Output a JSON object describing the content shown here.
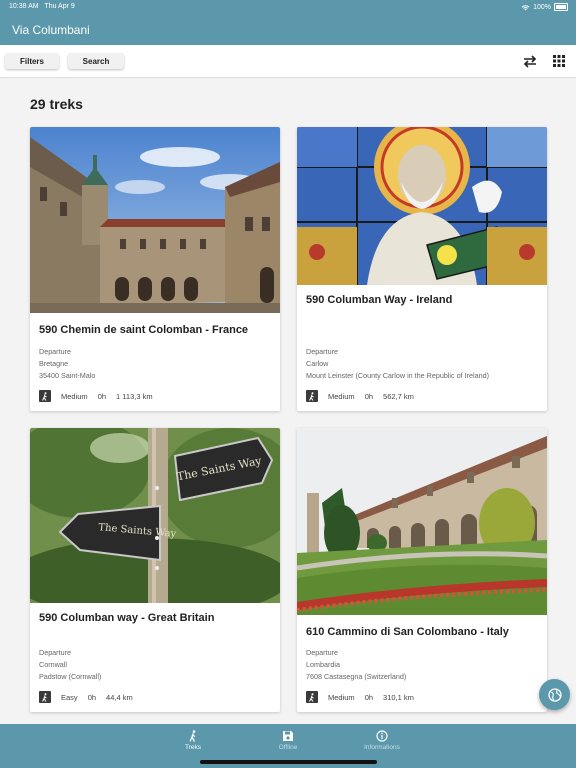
{
  "status": {
    "time": "10:38 AM",
    "date": "Thu Apr 9",
    "battery": "100%"
  },
  "app": {
    "title": "Via Columbani",
    "accent": "#5b98ac"
  },
  "toolbar": {
    "filters_label": "Filters",
    "search_label": "Search",
    "swap_icon": "swap-icon",
    "grid_icon": "grid-icon"
  },
  "list": {
    "count_label": "29 treks"
  },
  "cards": [
    {
      "title": "590 Chemin de saint Colomban - France",
      "departure_label": "Departure",
      "region": "Bretagne",
      "place": "35400 Saint-Malo",
      "difficulty": "Medium",
      "duration": "0h",
      "distance": "1 113,3 km",
      "image": "abbey-courtyard-photo"
    },
    {
      "title": "590 Columban Way - Ireland",
      "departure_label": "Departure",
      "region": "Carlow",
      "place": "Mount Leinster (County Carlow in the Republic of Ireland)",
      "difficulty": "Medium",
      "duration": "0h",
      "distance": "562,7 km",
      "image": "stained-glass-saint-photo"
    },
    {
      "title": "590 Columban way - Great Britain",
      "departure_label": "Departure",
      "region": "Cornwall",
      "place": "Padstow (Cornwall)",
      "difficulty": "Easy",
      "duration": "0h",
      "distance": "44,4 km",
      "image": "saints-way-signpost-photo",
      "sign_text_1": "The Saints Way",
      "sign_text_2": "The Saints Way"
    },
    {
      "title": "610 Cammino di San Colombano - Italy",
      "departure_label": "Departure",
      "region": "Lombardia",
      "place": "7608 Castasegna (Switzerland)",
      "difficulty": "Medium",
      "duration": "0h",
      "distance": "310,1 km",
      "image": "italian-cloister-garden-photo"
    }
  ],
  "tabs": [
    {
      "label": "Treks",
      "icon": "hiker-icon",
      "active": true
    },
    {
      "label": "Offline",
      "icon": "save-icon",
      "active": false
    },
    {
      "label": "Informations",
      "icon": "info-icon",
      "active": false
    }
  ],
  "fab_icon": "globe-icon"
}
